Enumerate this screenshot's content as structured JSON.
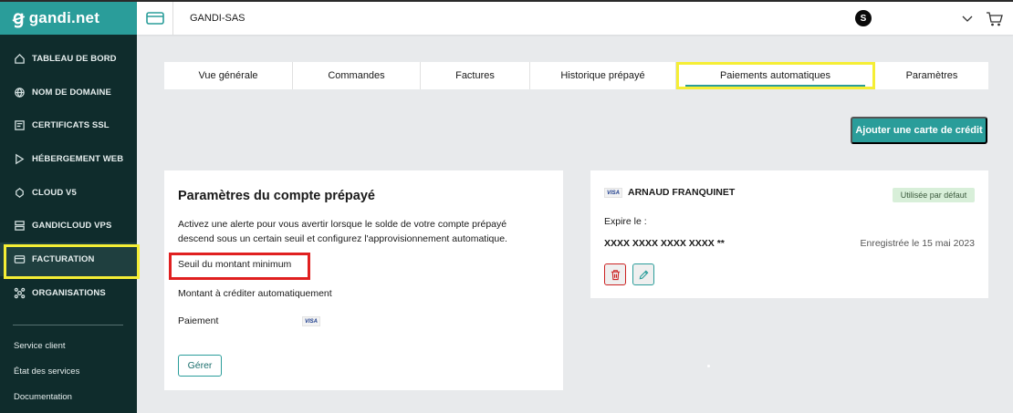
{
  "brand": {
    "logo_text": "gandi.net",
    "accent": "#2a9d9a",
    "sidebar_bg": "#0f2c2c"
  },
  "sidebar": {
    "items": [
      {
        "label": "TABLEAU DE BORD",
        "icon": "home-icon"
      },
      {
        "label": "NOM DE DOMAINE",
        "icon": "globe-icon"
      },
      {
        "label": "CERTIFICATS SSL",
        "icon": "certificate-icon"
      },
      {
        "label": "HÉBERGEMENT WEB",
        "icon": "play-icon"
      },
      {
        "label": "CLOUD V5",
        "icon": "cloud-icon"
      },
      {
        "label": "GANDICLOUD VPS",
        "icon": "server-icon"
      },
      {
        "label": "FACTURATION",
        "icon": "billing-icon",
        "active": true
      },
      {
        "label": "ORGANISATIONS",
        "icon": "organisations-icon"
      }
    ],
    "footer": [
      "Service client",
      "État des services",
      "Documentation"
    ]
  },
  "topbar": {
    "org_name": "GANDI-SAS",
    "avatar_letter": "S"
  },
  "tabs": [
    {
      "label": "Vue générale"
    },
    {
      "label": "Commandes"
    },
    {
      "label": "Factures"
    },
    {
      "label": "Historique prépayé"
    },
    {
      "label": "Paiements automatiques",
      "active": true
    },
    {
      "label": "Paramètres"
    }
  ],
  "add_card_label": "Ajouter une carte de crédit",
  "prepaid": {
    "title": "Paramètres du compte prépayé",
    "description": "Activez une alerte pour vous avertir lorsque le solde de votre compte prépayé descend sous un certain seuil et configurez l'approvisionnement automatique.",
    "min_threshold_label": "Seuil du montant minimum",
    "auto_credit_label": "Montant à créditer automatiquement",
    "payment_label": "Paiement",
    "payment_card_brand": "VISA",
    "manage_label": "Gérer"
  },
  "card": {
    "brand": "VISA",
    "holder": "ARNAUD FRANQUINET",
    "default_badge": "Utilisée par défaut",
    "expires_label": "Expire le :",
    "number": "XXXX XXXX XXXX XXXX **",
    "registered": "Enregistrée le 15 mai 2023"
  }
}
